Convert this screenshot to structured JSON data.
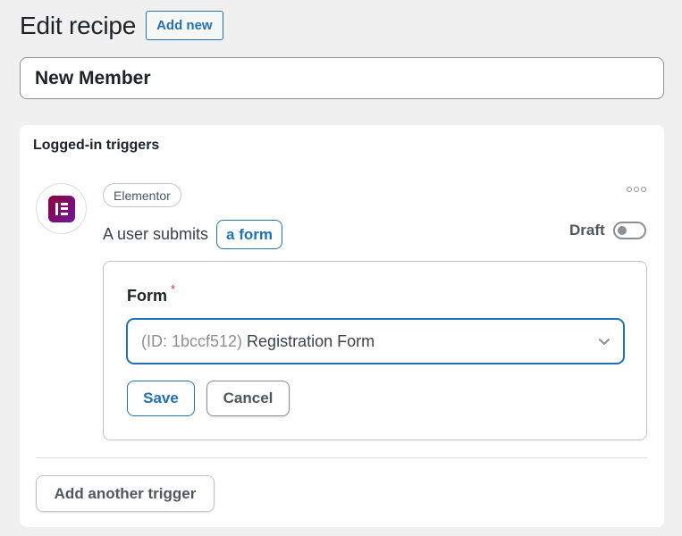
{
  "header": {
    "title": "Edit recipe",
    "add_new_label": "Add new"
  },
  "recipe": {
    "title_value": "New Member"
  },
  "triggers_panel": {
    "title": "Logged-in triggers",
    "trigger": {
      "integration": "Elementor",
      "integration_icon": "elementor-logo-icon",
      "sentence_text": "A user submits",
      "sentence_token": "a form",
      "status_label": "Draft",
      "status_enabled": false,
      "more_icon": "ellipsis-icon",
      "field": {
        "label": "Form",
        "required_mark": "*",
        "selected_id": "(ID: 1bccf512)",
        "selected_name": "Registration Form"
      },
      "save_label": "Save",
      "cancel_label": "Cancel"
    },
    "add_trigger_label": "Add another trigger"
  },
  "colors": {
    "accent": "#2271b1",
    "background": "#f0f0f1",
    "required": "#d63638",
    "elementor_brand": "#92003b"
  }
}
